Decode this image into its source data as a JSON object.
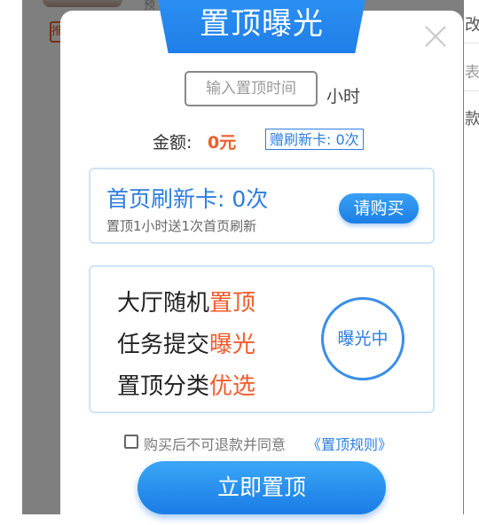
{
  "background": {
    "small_text": "预",
    "badge_text": "推",
    "right_items": [
      "改",
      "表",
      "款"
    ]
  },
  "modal": {
    "title": "置顶曝光",
    "time_input": {
      "placeholder": "输入置顶时间",
      "value": ""
    },
    "time_unit": "小时",
    "amount_label": "金额:",
    "amount_value": "0元",
    "gift_badge": "赠刷新卡: 0次",
    "refresh_card": {
      "title": "首页刷新卡: 0次",
      "subtitle": "置顶1小时送1次首页刷新",
      "buy_label": "请购买"
    },
    "features": [
      {
        "prefix": "大厅随机",
        "highlight": "置顶"
      },
      {
        "prefix": "任务提交",
        "highlight": "曝光"
      },
      {
        "prefix": "置顶分类",
        "highlight": "优选"
      }
    ],
    "exposure_label": "曝光中",
    "agreement": {
      "checked": false,
      "text": "购买后不可退款并同意",
      "link": "《置顶规则》"
    },
    "submit_label": "立即置顶"
  },
  "colors": {
    "primary_blue": "#1f7ee8",
    "highlight_orange": "#f25a2b"
  }
}
